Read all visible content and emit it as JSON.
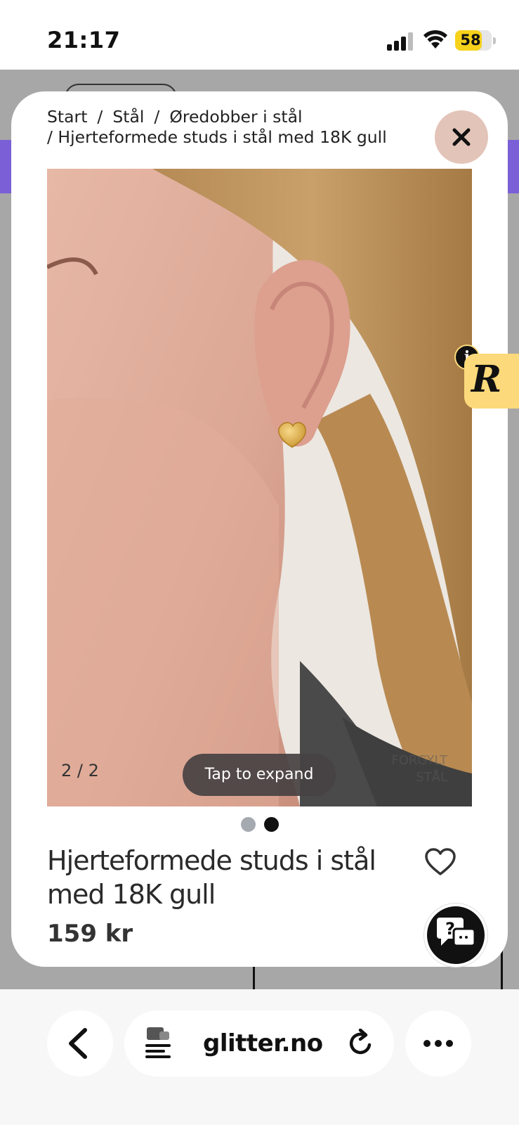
{
  "status_bar": {
    "time": "21:17",
    "battery": "58"
  },
  "modal": {
    "breadcrumb": {
      "line1": [
        "Start",
        "Stål",
        "Øredobber i stål"
      ],
      "line2": "Hjerteformede studs i stål med 18K gull",
      "separator": "/"
    },
    "gallery": {
      "counter": "2 / 2",
      "expand_label": "Tap to expand",
      "watermark_line1": "FORGYLT",
      "watermark_line2": "STÅL",
      "active_index": 2,
      "total": 2
    },
    "product": {
      "title": "Hjerteformede studs i stål med 18K gull",
      "price": "159 kr"
    },
    "help": {
      "icon_label": "?"
    }
  },
  "side_badge": {
    "letter": "R",
    "info": "i"
  },
  "browser": {
    "url": "glitter.no"
  },
  "colors": {
    "close_bg": "#e3c4b8",
    "badge_bg": "#fcd97a",
    "accent_purple": "#7a5fd6",
    "overlay_bg": "#a7a7a7"
  }
}
